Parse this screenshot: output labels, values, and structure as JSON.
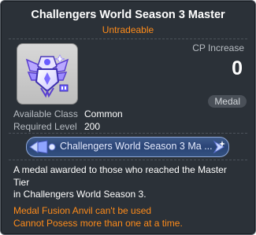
{
  "tooltip": {
    "title": "Challengers World Season 3 Master",
    "trade_status": "Untradeable",
    "cp_label": "CP Increase",
    "cp_value": "0",
    "type_badge": "Medal",
    "stats": [
      {
        "label": "Available Class",
        "value": "Common"
      },
      {
        "label": "Required Level",
        "value": "200"
      }
    ],
    "medal_name": "Challengers World Season 3 Ma ...",
    "description_lines": [
      "A medal awarded to those who reached the Master",
      "Tier",
      "in Challengers World Season 3."
    ],
    "warnings": [
      "Medal Fusion Anvil can't be used",
      "Cannot Posess more than one at a time."
    ],
    "icon": "medal-icon",
    "colors": {
      "background": "#2b3138",
      "accent_orange": "#ff8c1a",
      "medal_bar": "#2a4476"
    }
  }
}
